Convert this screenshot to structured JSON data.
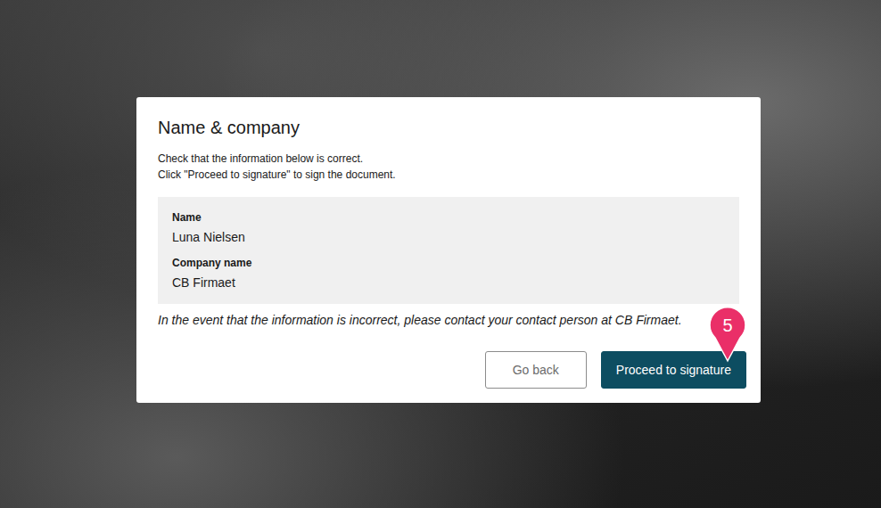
{
  "dialog": {
    "title": "Name & company",
    "instructions": [
      "Check that the information below is correct.",
      "Click \"Proceed to signature\" to sign the document."
    ],
    "fields": [
      {
        "label": "Name",
        "value": "Luna Nielsen"
      },
      {
        "label": "Company name",
        "value": "CB Firmaet"
      }
    ],
    "note": "In the event that the information is incorrect, please contact your contact person at CB Firmaet.",
    "buttons": [
      {
        "label": "Go back",
        "kind": "secondary"
      },
      {
        "label": "Proceed to signature",
        "kind": "primary"
      }
    ]
  },
  "marker": {
    "label": "5"
  }
}
